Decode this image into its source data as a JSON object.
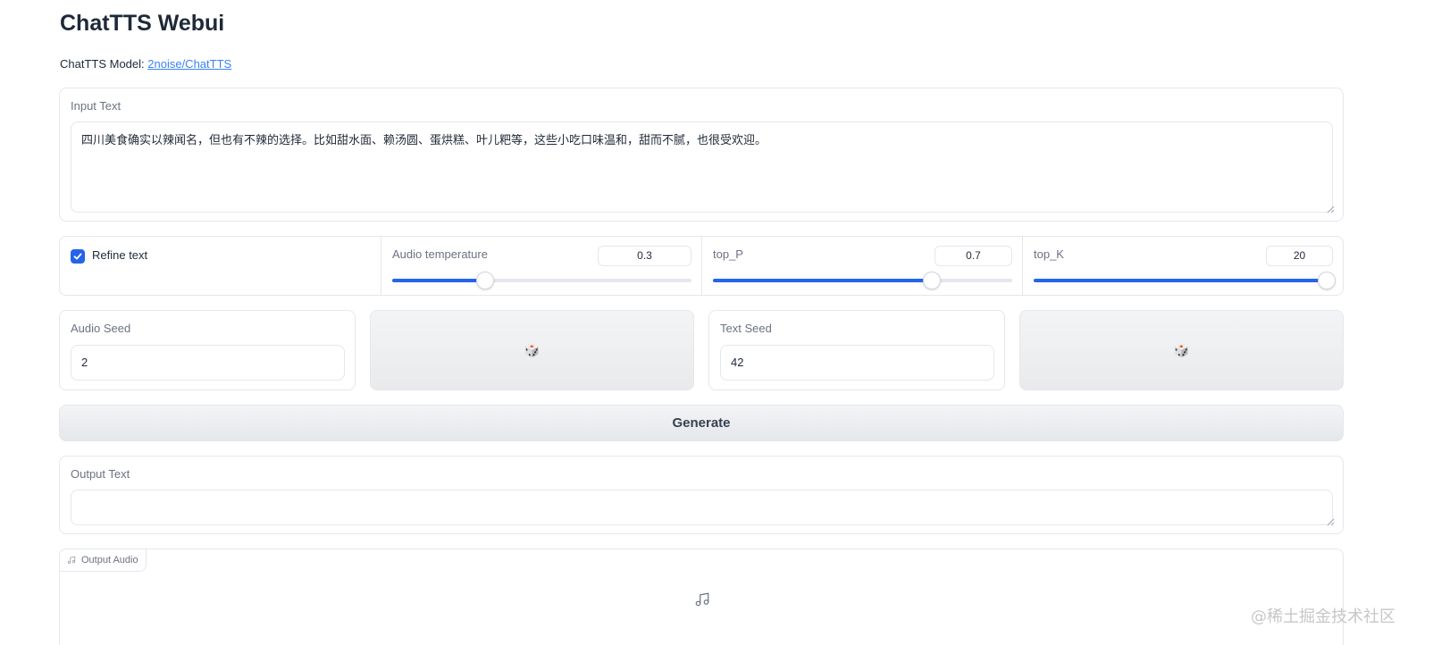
{
  "header": {
    "title": "ChatTTS Webui",
    "model_prefix": "ChatTTS Model: ",
    "model_link": "2noise/ChatTTS"
  },
  "input_text": {
    "label": "Input Text",
    "value": "四川美食确实以辣闻名，但也有不辣的选择。比如甜水面、赖汤圆、蛋烘糕、叶儿粑等，这些小吃口味温和，甜而不腻，也很受欢迎。"
  },
  "controls": {
    "refine_text": {
      "label": "Refine text",
      "checked": true
    },
    "audio_temperature": {
      "label": "Audio temperature",
      "value": "0.3",
      "fill": 0.31
    },
    "top_p": {
      "label": "top_P",
      "value": "0.7",
      "fill": 0.73
    },
    "top_k": {
      "label": "top_K",
      "value": "20",
      "fill": 0.98
    }
  },
  "seeds": {
    "audio_seed": {
      "label": "Audio Seed",
      "value": "2"
    },
    "text_seed": {
      "label": "Text Seed",
      "value": "42"
    },
    "dice_glyph": "🎲"
  },
  "generate": {
    "label": "Generate"
  },
  "output_text": {
    "label": "Output Text",
    "value": ""
  },
  "output_audio": {
    "label": "Output Audio",
    "icon": "music-note-icon"
  },
  "watermark": "@稀土掘金技术社区",
  "colors": {
    "accent": "#2563eb",
    "link": "#3b82f6",
    "border": "#e5e7eb"
  }
}
